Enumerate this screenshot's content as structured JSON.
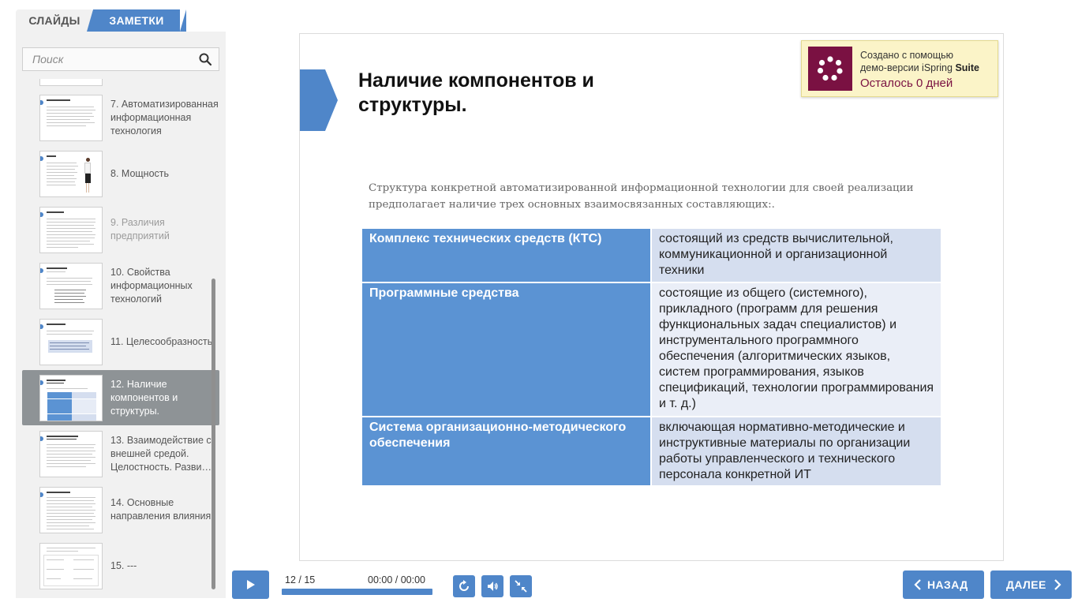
{
  "tabs": {
    "slides": "СЛАЙДЫ",
    "notes": "ЗАМЕТКИ"
  },
  "search": {
    "placeholder": "Поиск"
  },
  "outline": [
    {
      "number": "7",
      "label": "7. Автоматизированная информационная технология",
      "state": "normal"
    },
    {
      "number": "8",
      "label": "8. Мощность",
      "state": "normal"
    },
    {
      "number": "9",
      "label": "9. Различия предприятий",
      "state": "dim"
    },
    {
      "number": "10",
      "label": "10. Свойства информационных технологий",
      "state": "normal"
    },
    {
      "number": "11",
      "label": "11. Целесообразность",
      "state": "normal"
    },
    {
      "number": "12",
      "label": "12. Наличие компонентов и структуры.",
      "state": "active"
    },
    {
      "number": "13",
      "label": "13. Взаимодействие с внешней средой. Целостность. Разви…",
      "state": "normal"
    },
    {
      "number": "14",
      "label": "14. Основные направления влияния",
      "state": "normal"
    },
    {
      "number": "15",
      "label": "15. ---",
      "state": "normal"
    }
  ],
  "slide": {
    "title": "Наличие компонентов и структуры.",
    "intro": "Структура конкретной автоматизированной информационной технологии для своей реализации предполагает наличие трех основных взаимосвязанных составляющих:.",
    "table": [
      {
        "key": "Комплекс технических средств (КТС)",
        "value": "состоящий из средств вычислительной, коммуникационной и организационной техники"
      },
      {
        "key": "Программные средства",
        "value": "состоящие из общего (системного), прикладного (программ для решения функциональных задач специалистов) и инструментального программного обеспечения (алгоритмических языков, систем программирования, языков спецификаций, технологии программирования и т. д.)"
      },
      {
        "key": "Система организационно-методического обеспечения",
        "value": "включающая нормативно-методические и инструктивные материалы по организации работы управленческого и технического персонала конкретной ИТ"
      }
    ]
  },
  "watermark": {
    "line1": "Создано с помощью",
    "line2_prefix": "демо-версии iSpring ",
    "line2_bold": "Suite",
    "line3": "Осталось 0 дней",
    "logo_color": "#7a1142"
  },
  "player": {
    "counter": "12 / 15",
    "time": "00:00 / 00:00",
    "progress": 1.0,
    "back_label": "НАЗАД",
    "next_label": "ДАЛЕЕ"
  },
  "colors": {
    "accent": "#4f86c9",
    "table_key_bg": "#5b93d3",
    "table_value_bg": "#d5deef"
  },
  "icons": [
    "search-icon",
    "play-icon",
    "replay-icon",
    "volume-icon",
    "collapse-icon",
    "chevron-left-icon",
    "chevron-right-icon"
  ]
}
